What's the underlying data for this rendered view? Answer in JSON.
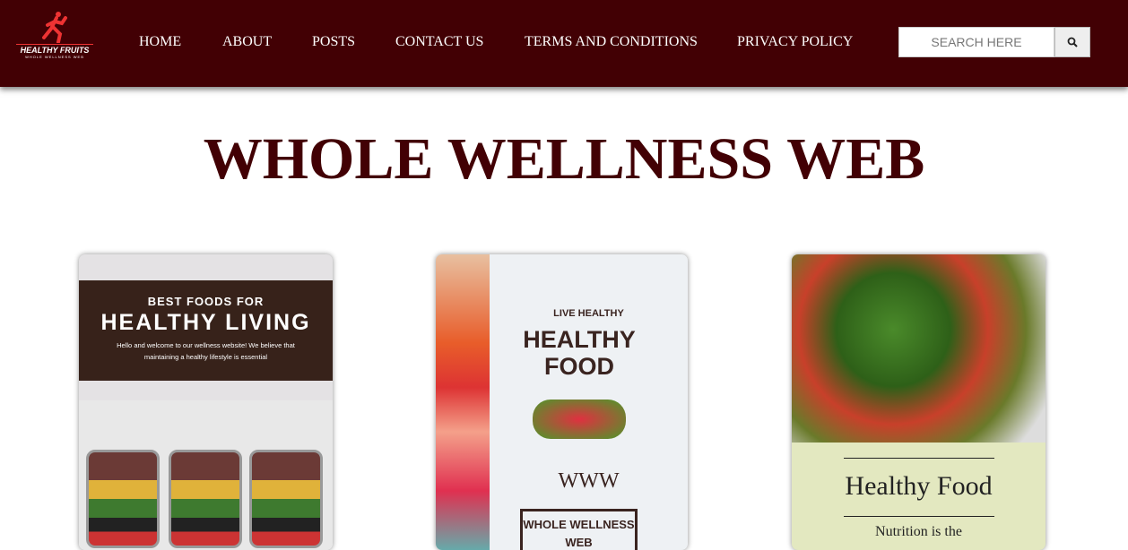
{
  "nav": {
    "logo_title": "HEALTHY FRUITS",
    "logo_subtitle": "WHOLE WELLNESS WEB",
    "items": [
      "HOME",
      "ABOUT",
      "POSTS",
      "CONTACT US",
      "TERMS AND CONDITIONS",
      "PRIVACY POLICY"
    ],
    "search_placeholder": "SEARCH HERE"
  },
  "page_title": "WHOLE WELLNESS WEB",
  "cards": [
    {
      "kicker": "BEST FOODS FOR",
      "title": "HEALTHY LIVING",
      "text": "Hello and welcome to our wellness website! We believe that maintaining a healthy lifestyle is essential"
    },
    {
      "kicker": "LIVE   HEALTHY",
      "title": "HEALTHY FOOD",
      "www": "WWW",
      "box": "WHOLE WELLNESS WEB"
    },
    {
      "title": "Healthy Food",
      "text": "Nutrition is the"
    }
  ]
}
